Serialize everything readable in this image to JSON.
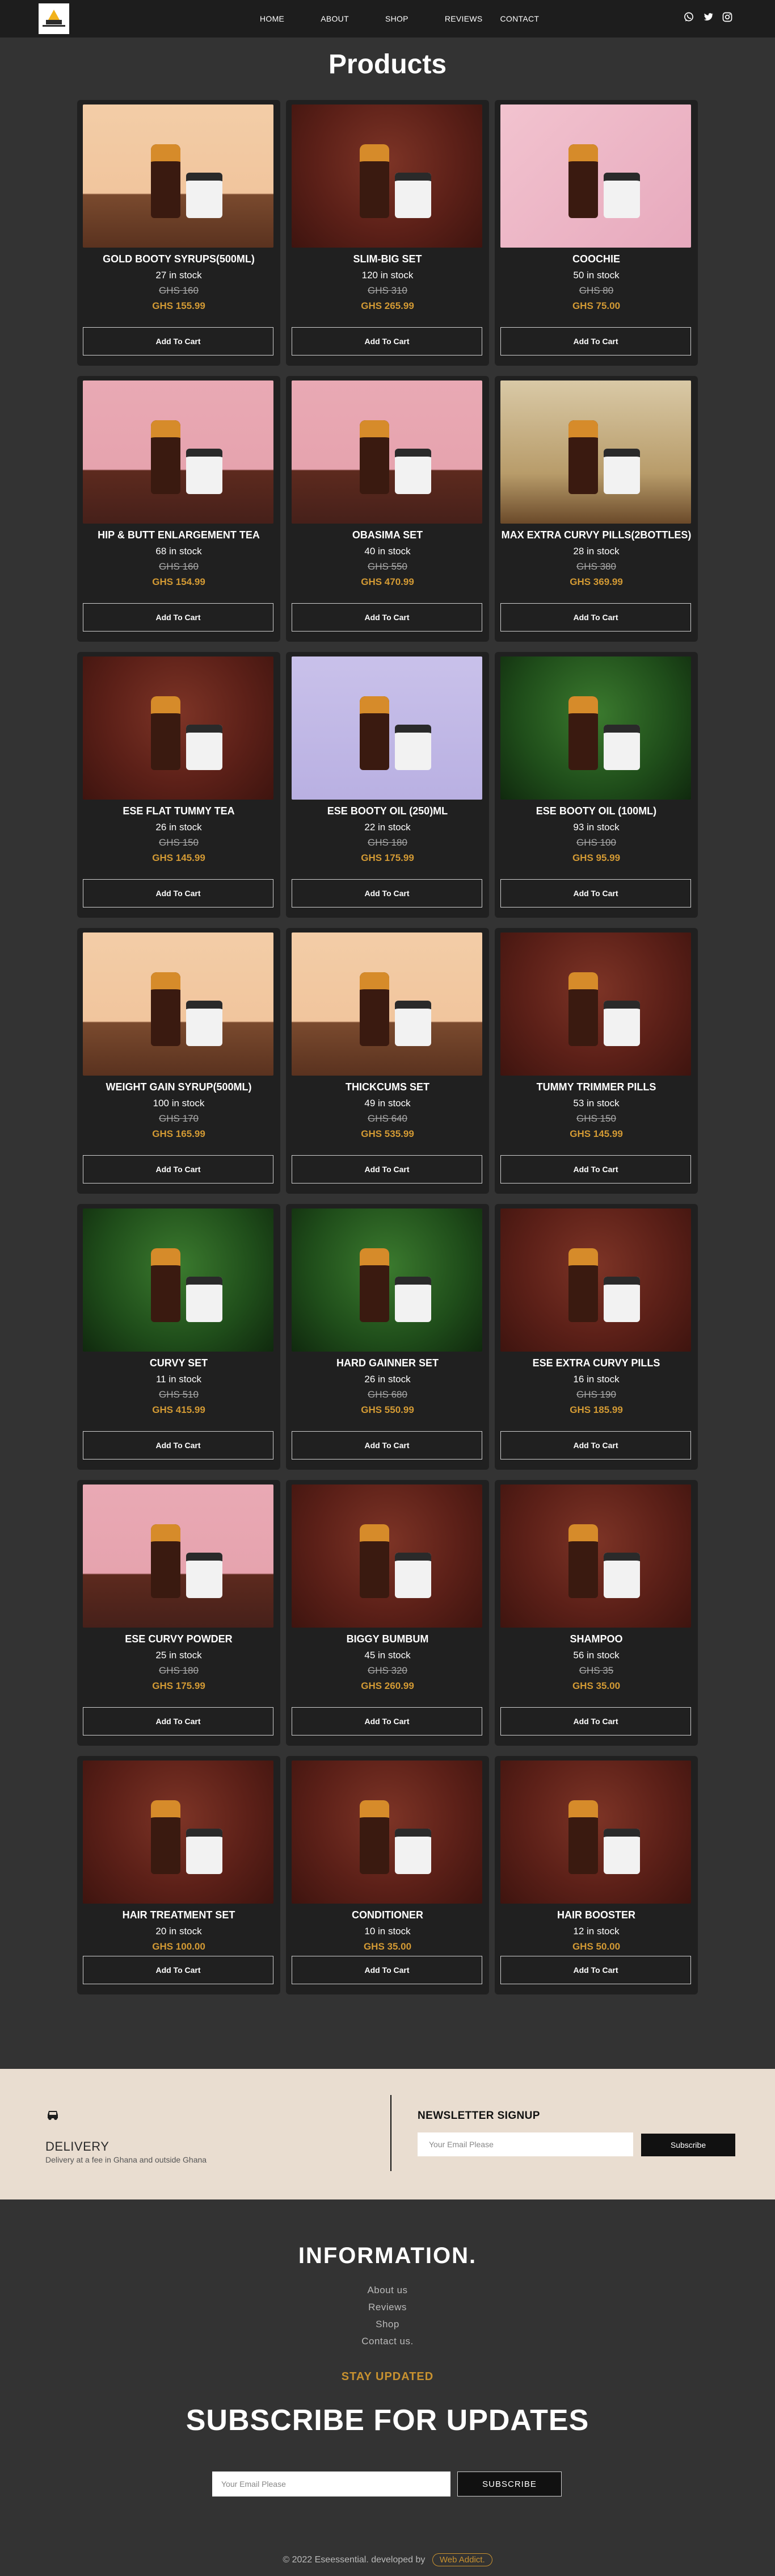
{
  "nav": {
    "links": [
      "HOME",
      "ABOUT",
      "SHOP",
      "REVIEWS",
      "CONTACT"
    ]
  },
  "page_title": "Products",
  "cart_label": "Add To Cart",
  "products": [
    {
      "name": "GOLD BOOTY SYRUPS(500ML)",
      "stock": "27 in stock",
      "old_price": "GHS 160",
      "price": "GHS 155.99",
      "bg": "peach"
    },
    {
      "name": "SLIM-BIG SET",
      "stock": "120 in stock",
      "old_price": "GHS 310",
      "price": "GHS 265.99",
      "bg": "brown"
    },
    {
      "name": "COOCHIE",
      "stock": "50 in stock",
      "old_price": "GHS 80",
      "price": "GHS 75.00",
      "bg": "magenta"
    },
    {
      "name": "HIP & BUTT ENLARGEMENT TEA",
      "stock": "68 in stock",
      "old_price": "GHS 160",
      "price": "GHS 154.99",
      "bg": "pink"
    },
    {
      "name": "OBASIMA SET",
      "stock": "40 in stock",
      "old_price": "GHS 550",
      "price": "GHS 470.99",
      "bg": "pink"
    },
    {
      "name": "MAX EXTRA CURVY PILLS(2BOTTLES)",
      "stock": "28 in stock",
      "old_price": "GHS 380",
      "price": "GHS 369.99",
      "bg": "tan"
    },
    {
      "name": "ESE FLAT TUMMY TEA",
      "stock": "26 in stock",
      "old_price": "GHS 150",
      "price": "GHS 145.99",
      "bg": "brown"
    },
    {
      "name": "ESE BOOTY OIL (250)ML",
      "stock": "22 in stock",
      "old_price": "GHS 180",
      "price": "GHS 175.99",
      "bg": "lav"
    },
    {
      "name": "ESE BOOTY OIL (100ML)",
      "stock": "93 in stock",
      "old_price": "GHS 100",
      "price": "GHS 95.99",
      "bg": "green"
    },
    {
      "name": "WEIGHT GAIN SYRUP(500ML)",
      "stock": "100 in stock",
      "old_price": "GHS 170",
      "price": "GHS 165.99",
      "bg": "peach"
    },
    {
      "name": "THICKCUMS SET",
      "stock": "49 in stock",
      "old_price": "GHS 640",
      "price": "GHS 535.99",
      "bg": "peach"
    },
    {
      "name": "TUMMY TRIMMER PILLS",
      "stock": "53 in stock",
      "old_price": "GHS 150",
      "price": "GHS 145.99",
      "bg": "brown"
    },
    {
      "name": "CURVY SET",
      "stock": "11 in stock",
      "old_price": "GHS 510",
      "price": "GHS 415.99",
      "bg": "green"
    },
    {
      "name": "HARD GAINNER SET",
      "stock": "26 in stock",
      "old_price": "GHS 680",
      "price": "GHS 550.99",
      "bg": "green"
    },
    {
      "name": "ESE EXTRA CURVY PILLS",
      "stock": "16 in stock",
      "old_price": "GHS 190",
      "price": "GHS 185.99",
      "bg": "brown"
    },
    {
      "name": "ESE CURVY POWDER",
      "stock": "25 in stock",
      "old_price": "GHS 180",
      "price": "GHS 175.99",
      "bg": "pink"
    },
    {
      "name": "BIGGY BUMBUM",
      "stock": "45 in stock",
      "old_price": "GHS 320",
      "price": "GHS 260.99",
      "bg": "brown"
    },
    {
      "name": "SHAMPOO",
      "stock": "56 in stock",
      "old_price": "GHS 35",
      "price": "GHS 35.00",
      "bg": "brown"
    },
    {
      "name": "HAIR TREATMENT SET",
      "stock": "20 in stock",
      "old_price": "",
      "price": "GHS 100.00",
      "bg": "brown"
    },
    {
      "name": "CONDITIONER",
      "stock": "10 in stock",
      "old_price": "",
      "price": "GHS 35.00",
      "bg": "brown"
    },
    {
      "name": "HAIR BOOSTER",
      "stock": "12 in stock",
      "old_price": "",
      "price": "GHS 50.00",
      "bg": "brown"
    }
  ],
  "delivery": {
    "title": "DELIVERY",
    "text": "Delivery at a fee in Ghana and outside Ghana"
  },
  "newsletter": {
    "title": "NEWSLETTER SIGNUP",
    "placeholder": "Your Email Please",
    "button": "Subscribe"
  },
  "information": {
    "title": "INFORMATION.",
    "links": [
      "About us",
      "Reviews",
      "Shop",
      "Contact us."
    ]
  },
  "subscribe": {
    "eyebrow": "STAY UPDATED",
    "title": "SUBSCRIBE FOR UPDATES",
    "placeholder": "Your Email Please",
    "button": "SUBSCRIBE"
  },
  "footer": {
    "copyright": "© 2022 Eseessential. developed by",
    "developer": "Web Addict."
  },
  "colors": {
    "page_bg": "#333333",
    "nav_bg": "#1d1d1d",
    "card_bg": "#202020",
    "price_accent": "#d39a34",
    "band_bg": "#e9ddd0"
  },
  "icons": [
    "whatsapp-icon",
    "twitter-icon",
    "instagram-icon",
    "truck-icon"
  ]
}
